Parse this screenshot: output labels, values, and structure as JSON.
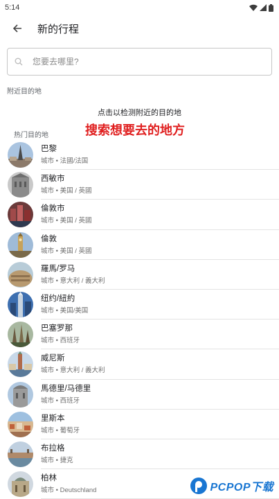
{
  "status": {
    "time": "5:14",
    "icons": [
      "wifi-icon",
      "signal-icon",
      "battery-icon"
    ]
  },
  "header": {
    "title": "新的行程",
    "back_icon": "arrow-back-icon"
  },
  "search": {
    "placeholder": "您要去哪里?",
    "value": "",
    "icon": "search-icon"
  },
  "nearby": {
    "label": "附近目的地",
    "hint": "点击以检测附近的目的地"
  },
  "popular": {
    "label": "热门目的地",
    "promo": "搜索想要去的地方"
  },
  "cities": [
    {
      "name": "巴黎",
      "meta": "城市 • 法國/法国"
    },
    {
      "name": "西敏市",
      "meta": "城市 • 美国 / 英國"
    },
    {
      "name": "倫敦市",
      "meta": "城市 • 美国 / 英國"
    },
    {
      "name": "倫敦",
      "meta": "城市 • 美国 / 英國"
    },
    {
      "name": "羅馬/罗马",
      "meta": "城市 • 意大利 / 義大利"
    },
    {
      "name": "纽约/紐約",
      "meta": "城市 • 美国/美国"
    },
    {
      "name": "巴塞罗那",
      "meta": "城市 • 西班牙"
    },
    {
      "name": "威尼斯",
      "meta": "城市 • 意大利 / 義大利"
    },
    {
      "name": "馬德里/马德里",
      "meta": "城市 • 西班牙"
    },
    {
      "name": "里斯本",
      "meta": "城市 • 葡萄牙"
    },
    {
      "name": "布拉格",
      "meta": "城市 • 捷克"
    },
    {
      "name": "柏林",
      "meta": "城市 • Deutschland"
    }
  ],
  "watermark": {
    "text": "PCPOP下载"
  },
  "colors": {
    "promo": "#e02020",
    "accent": "#1976d2"
  }
}
